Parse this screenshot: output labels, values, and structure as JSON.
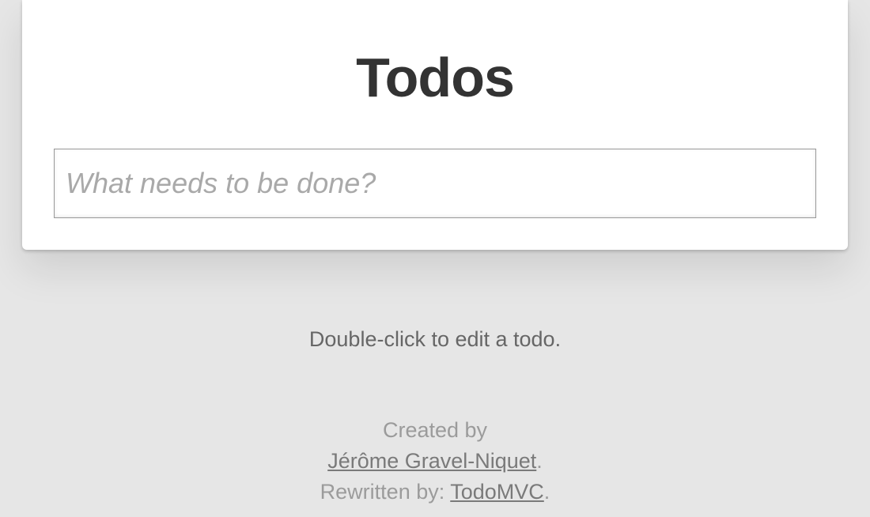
{
  "header": {
    "title": "Todos"
  },
  "input": {
    "placeholder": "What needs to be done?",
    "value": ""
  },
  "info": {
    "hint": "Double-click to edit a todo.",
    "created_by_label": "Created by",
    "author_name": "Jérôme Gravel-Niquet",
    "author_suffix": ".",
    "rewritten_by_label": "Rewritten by: ",
    "rewriter_name": "TodoMVC",
    "rewriter_suffix": "."
  }
}
